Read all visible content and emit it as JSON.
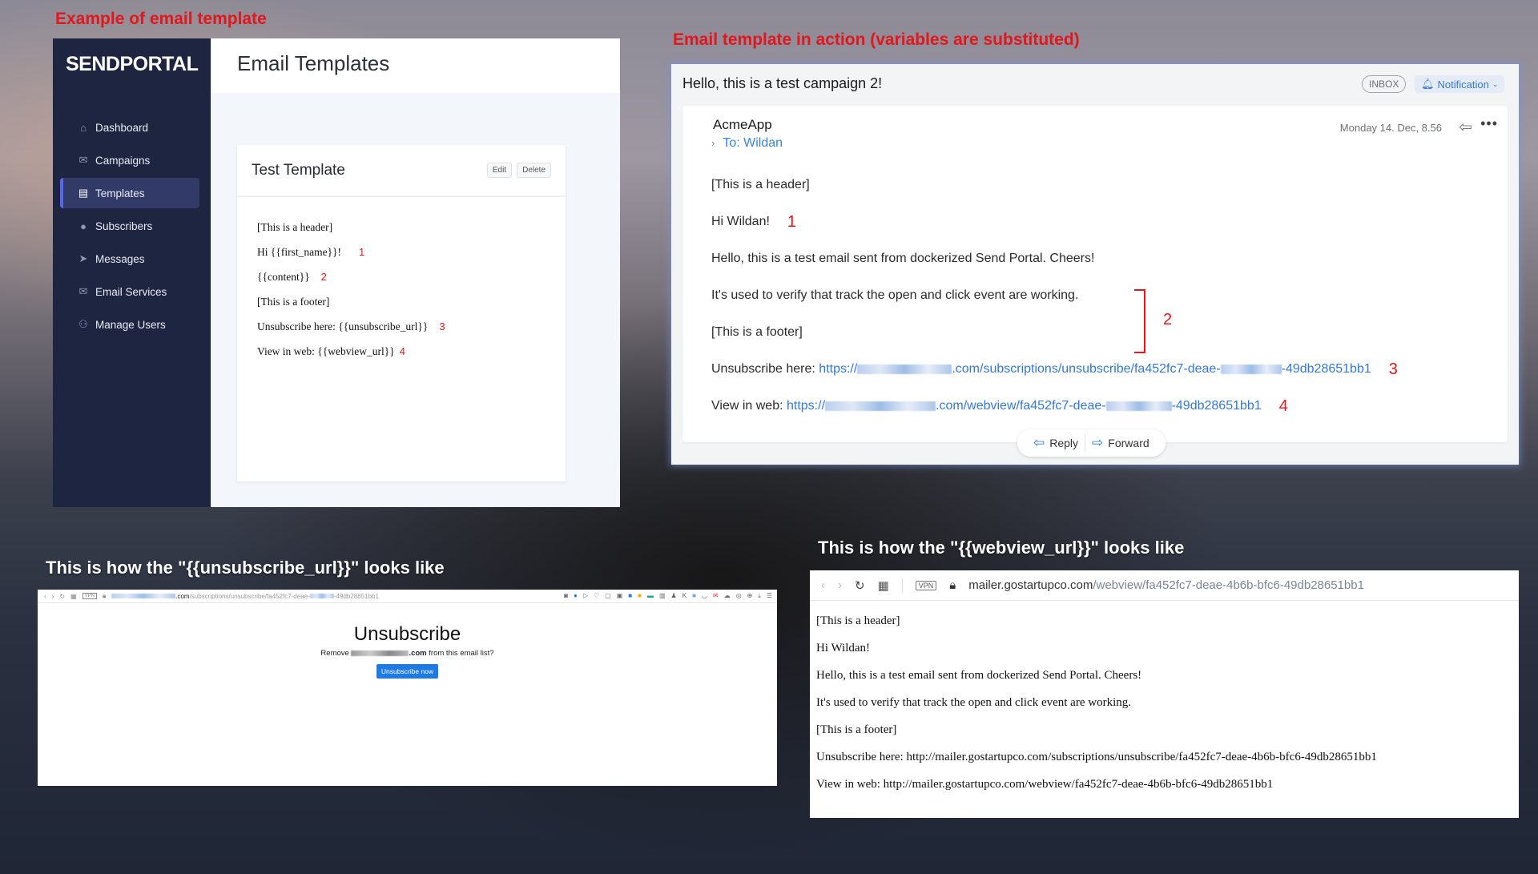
{
  "captions": {
    "template": "Example of email template",
    "in_action": "Email template in action (variables are substituted)",
    "unsubscribe": "This is how the \"{{unsubscribe_url}}\" looks like",
    "webview": "This is how the \"{{webview_url}}\" looks like"
  },
  "sendportal": {
    "logo": "SENDPORTAL",
    "page_title": "Email Templates",
    "nav": [
      {
        "label": "Dashboard",
        "icon": "home-icon",
        "glyph": "⌂"
      },
      {
        "label": "Campaigns",
        "icon": "envelope-icon",
        "glyph": "✉"
      },
      {
        "label": "Templates",
        "icon": "file-icon",
        "glyph": "▤",
        "active": true
      },
      {
        "label": "Subscribers",
        "icon": "user-icon",
        "glyph": "●"
      },
      {
        "label": "Messages",
        "icon": "paper-plane-icon",
        "glyph": "➤"
      },
      {
        "label": "Email Services",
        "icon": "envelope-icon",
        "glyph": "✉"
      },
      {
        "label": "Manage Users",
        "icon": "users-icon",
        "glyph": "⚇"
      }
    ],
    "card": {
      "title": "Test Template",
      "edit_label": "Edit",
      "delete_label": "Delete",
      "lines": [
        {
          "text": "[This is a header]",
          "anno": ""
        },
        {
          "text": "Hi {{first_name}}!",
          "anno": "1"
        },
        {
          "text": "{{content}}",
          "anno": "2"
        },
        {
          "text": "[This is a footer]",
          "anno": ""
        },
        {
          "text": "Unsubscribe here: {{unsubscribe_url}}",
          "anno": "3"
        },
        {
          "text": "View in web: {{webview_url}}",
          "anno": "4"
        }
      ]
    }
  },
  "mail": {
    "subject": "Hello, this is a test campaign 2!",
    "inbox_badge": "INBOX",
    "notification_label": "Notification",
    "from": "AcmeApp",
    "to": "To: Wildan",
    "date": "Monday 14. Dec, 8.56",
    "body": {
      "header": "[This is a header]",
      "greeting": "Hi Wildan!",
      "greeting_anno": "1",
      "content1": "Hello, this is a test email sent from dockerized Send Portal. Cheers!",
      "content2": "It's used to verify that track the open and click event are working.",
      "content_anno": "2",
      "footer": "[This is a footer]",
      "unsub_label": "Unsubscribe here: ",
      "unsub_link_prefix": "https://",
      "unsub_link_mid": ".com/subscriptions/unsubscribe/fa452fc7-deae-",
      "unsub_link_suffix": "-49db28651bb1",
      "unsub_anno": "3",
      "web_label": "View in web: ",
      "web_link_prefix": "https://",
      "web_link_mid": ".com/webview/fa452fc7-deae-",
      "web_link_suffix": "-49db28651bb1",
      "web_anno": "4"
    },
    "reply_label": "Reply",
    "forward_label": "Forward"
  },
  "unsubscribe_page": {
    "url_domain": ".com",
    "url_path": "/subscriptions/unsubscribe/fa452fc7-deae-",
    "url_suffix": "-49db28651bb1",
    "heading": "Unsubscribe",
    "question_prefix": "Remove ",
    "question_domain": ".com",
    "question_suffix": " from this email list?",
    "button_label": "Unsubscribe now"
  },
  "webview_page": {
    "url_domain": "mailer.gostartupco.com",
    "url_path": "/webview/fa452fc7-deae-4b6b-bfc6-49db28651bb1",
    "lines": [
      "[This is a header]",
      "Hi Wildan!",
      "Hello, this is a test email sent from dockerized Send Portal. Cheers!",
      "It's used to verify that track the open and click event are working.",
      "[This is a footer]",
      "Unsubscribe here: http://mailer.gostartupco.com/subscriptions/unsubscribe/fa452fc7-deae-4b6b-bfc6-49db28651bb1",
      "View in web: http://mailer.gostartupco.com/webview/fa452fc7-deae-4b6b-bfc6-49db28651bb1"
    ]
  },
  "colors": {
    "annotation_red": "#e2161c",
    "sidebar_bg": "#1e2541",
    "sidebar_active": "#323b67",
    "link_blue": "#3478d4"
  }
}
